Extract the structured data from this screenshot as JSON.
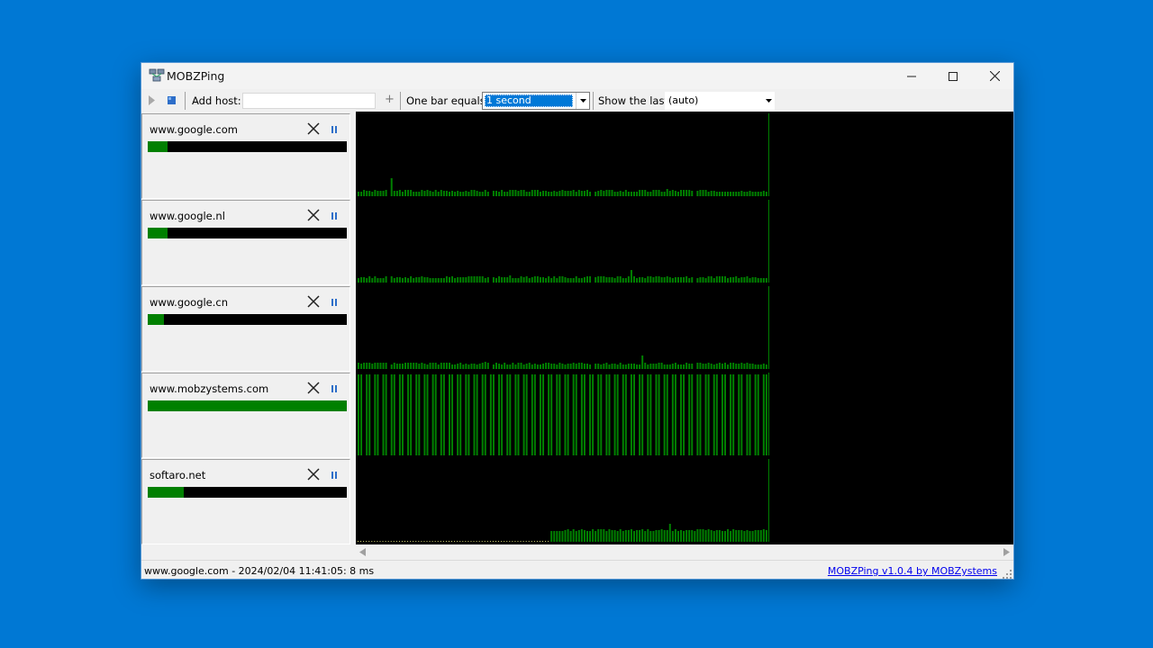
{
  "window": {
    "title": "MOBZPing",
    "icon": "network-computers-icon"
  },
  "toolbar": {
    "play_icon": "play-icon",
    "stop_icon": "stop-icon",
    "add_host_label": "Add host:",
    "add_host_value": "",
    "add_button": "+",
    "one_bar_label": "One bar equals:",
    "one_bar_value": "1 second",
    "show_last_label": "Show the last:",
    "show_last_value": "(auto)"
  },
  "hosts": [
    {
      "name": "www.google.com",
      "progress": 0.1
    },
    {
      "name": "www.google.nl",
      "progress": 0.1
    },
    {
      "name": "www.google.cn",
      "progress": 0.08
    },
    {
      "name": "www.mobzystems.com",
      "progress": 1.0
    },
    {
      "name": "softaro.net",
      "progress": 0.18
    }
  ],
  "status": {
    "text": "www.google.com - 2024/02/04 11:41:05: 8 ms",
    "link": "MOBZPing v1.0.4 by MOBZystems"
  },
  "colors": {
    "desktop": "#0078d4",
    "bar_green": "#008000",
    "graph_bg": "#000000",
    "link": "#0000ee"
  }
}
